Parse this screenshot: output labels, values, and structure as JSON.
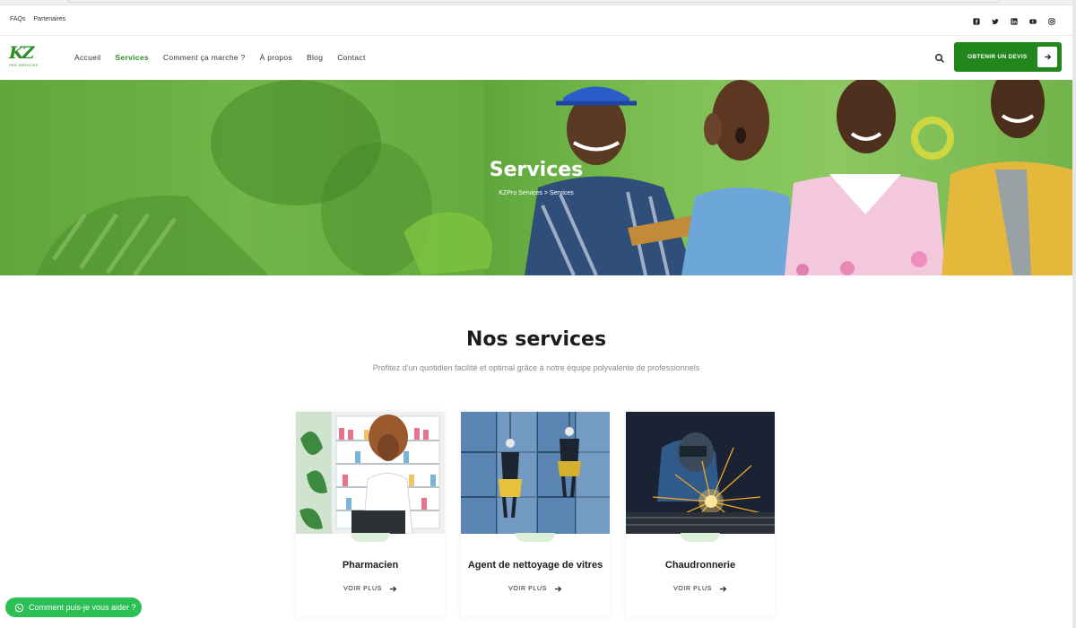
{
  "topbar": {
    "links": [
      "FAQs",
      "Partenaires"
    ],
    "social_icons": [
      "facebook-icon",
      "twitter-icon",
      "linkedin-icon",
      "youtube-icon",
      "instagram-icon"
    ]
  },
  "brand": {
    "logo_mark": "KZ",
    "logo_sub": "PRO SERVICES",
    "primary_color": "#22861c"
  },
  "nav": {
    "items": [
      {
        "label": "Accueil",
        "active": false
      },
      {
        "label": "Services",
        "active": true
      },
      {
        "label": "Comment ça marche ?",
        "active": false
      },
      {
        "label": "À propos",
        "active": false
      },
      {
        "label": "Blog",
        "active": false
      },
      {
        "label": "Contact",
        "active": false
      }
    ],
    "cta_label": "OBTENIR UN DEVIS"
  },
  "hero": {
    "title": "Services",
    "breadcrumb": "KZPro Services > Services"
  },
  "section": {
    "title": "Nos services",
    "subtitle": "Profitez d'un quotidien facilité et optimal grâce à notre équipe polyvalente de professionnels"
  },
  "cards": [
    {
      "title": "Pharmacien",
      "more": "VOIR PLUS"
    },
    {
      "title": "Agent de nettoyage de vitres",
      "more": "VOIR PLUS"
    },
    {
      "title": "Chaudronnerie",
      "more": "VOIR PLUS"
    }
  ],
  "chat": {
    "label": "Comment puis-je vous aider ?"
  }
}
